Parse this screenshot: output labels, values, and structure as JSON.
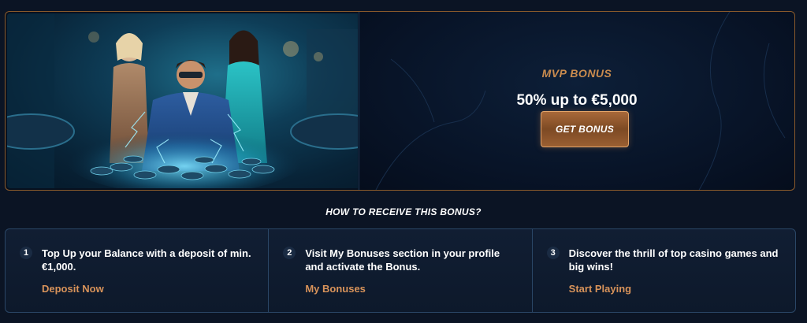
{
  "hero": {
    "kicker": "MVP BONUS",
    "title": "50% up to €5,000",
    "cta_label": "GET BONUS",
    "image_alt": "casino-hero-image"
  },
  "howto": {
    "title": "HOW TO RECEIVE THIS BONUS?",
    "steps": [
      {
        "number": "1",
        "text": "Top Up your Balance with a deposit of min. €1,000.",
        "link": "Deposit Now"
      },
      {
        "number": "2",
        "text": "Visit My Bonuses section in your profile and activate the Bonus.",
        "link": "My Bonuses"
      },
      {
        "number": "3",
        "text": "Discover the thrill of top casino games and big wins!",
        "link": "Start Playing"
      }
    ]
  },
  "colors": {
    "accent": "#c98b4e",
    "link": "#d8935a",
    "background": "#0b1424",
    "card_border": "#2a4666"
  }
}
